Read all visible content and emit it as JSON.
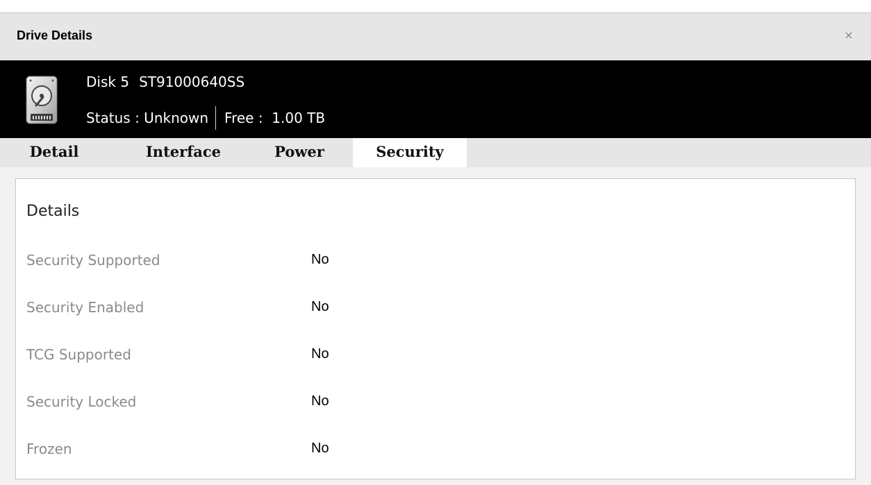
{
  "dialog": {
    "title": "Drive Details",
    "close_glyph": "×"
  },
  "drive": {
    "icon": "hard-drive-icon",
    "disk_label": "Disk",
    "disk_number": "5",
    "model": "ST91000640SS",
    "status_text": "Status : Unknown",
    "free_text": "Free :  1.00 TB"
  },
  "tabs": [
    {
      "label": "Detail",
      "active": false
    },
    {
      "label": "Interface",
      "active": false
    },
    {
      "label": "Power",
      "active": false
    },
    {
      "label": "Security",
      "active": true
    }
  ],
  "panel": {
    "section_title": "Details",
    "rows": [
      {
        "label": "Security Supported",
        "value": "No"
      },
      {
        "label": "Security Enabled",
        "value": "No"
      },
      {
        "label": "TCG Supported",
        "value": "No"
      },
      {
        "label": "Security Locked",
        "value": "No"
      },
      {
        "label": "Frozen",
        "value": "No"
      }
    ]
  },
  "colors": {
    "header_bg": "#000000",
    "titlebar_bg": "#e6e6e6",
    "active_tab_bg": "#ffffff",
    "label_color": "#8a8a8a"
  }
}
